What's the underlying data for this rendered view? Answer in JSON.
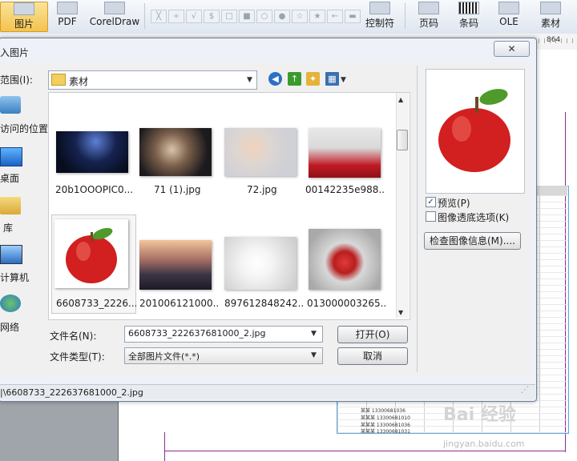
{
  "ribbon": {
    "buttons": [
      {
        "label": "图片"
      },
      {
        "label": "PDF"
      },
      {
        "label": "CorelDraw"
      },
      {
        "label": "控制符"
      },
      {
        "label": "页码"
      },
      {
        "label": "条码"
      },
      {
        "label": "OLE"
      },
      {
        "label": "素材"
      }
    ],
    "symbols": [
      "╳",
      "÷",
      "√",
      "$",
      "□",
      "■",
      "○",
      "●",
      "☆",
      "★",
      "←",
      "▬"
    ]
  },
  "ruler": {
    "number": "864"
  },
  "dialog": {
    "title": "入图片",
    "lookin_label": "范围(I):",
    "lookin_value": "素材",
    "places": [
      {
        "label": "访问的位置"
      },
      {
        "label": "桌面"
      },
      {
        "label": "库"
      },
      {
        "label": "计算机"
      },
      {
        "label": "网络"
      }
    ],
    "files": [
      {
        "name": "20b1OOOPIC0..."
      },
      {
        "name": "71 (1).jpg"
      },
      {
        "name": "72.jpg"
      },
      {
        "name": "00142235e988..."
      },
      {
        "name": "6608733_2226..."
      },
      {
        "name": "201006121000..."
      },
      {
        "name": "897612848242..."
      },
      {
        "name": "013000003265..."
      }
    ],
    "preview_label": "预览(P)",
    "transparency_label": "图像透底选项(K)",
    "info_button": "检查图像信息(M)....",
    "filename_label": "文件名(N):",
    "filename_value": "6608733_222637681000_2.jpg",
    "filetype_label": "文件类型(T):",
    "filetype_value": "全部图片文件(*.*)",
    "open_button": "打开(O)",
    "cancel_button": "取消",
    "status_path": "|\\6608733_222637681000_2.jpg"
  },
  "watermark": "jingyan.baidu.com",
  "watermark_logo": "Bai 经验",
  "mini_table_rows": [
    "某某   13300681036",
    "某某某  13300681010",
    "某某某  13300681036",
    "某某某  13300681031"
  ],
  "colors": {
    "accent": "#f3c34e",
    "apple": "#d21f1f",
    "leaf": "#4f9a2a"
  }
}
